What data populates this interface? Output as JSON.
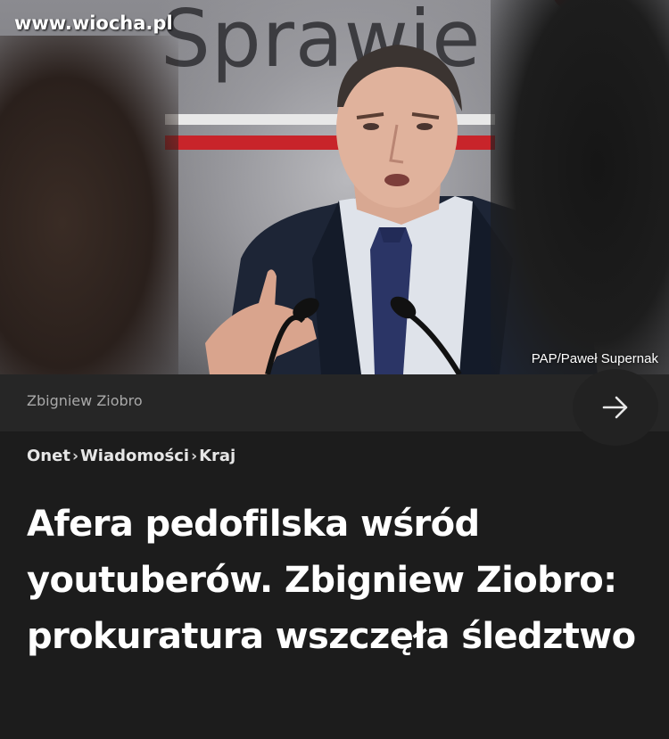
{
  "watermark": "www.wiocha.pl",
  "photo": {
    "backdrop_text": "Sprawie",
    "credit": "PAP/Paweł Supernak"
  },
  "tag": {
    "label": "Zbigniew Ziobro",
    "arrow_icon": "arrow-right-icon"
  },
  "breadcrumb": {
    "items": [
      "Onet",
      "Wiadomości",
      "Kraj"
    ],
    "separator": "›"
  },
  "article": {
    "title": "Afera pedofilska wśród youtuberów. Zbigniew Ziobro: prokuratura wszczęła śledztwo"
  },
  "colors": {
    "background": "#1c1c1c",
    "tag_bar": "#262626",
    "flag_red": "#c8242a"
  }
}
